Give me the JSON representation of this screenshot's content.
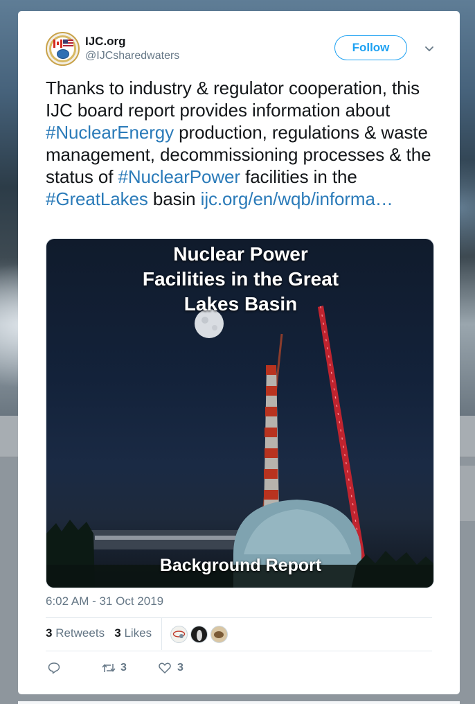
{
  "tweet": {
    "author": {
      "name": "IJC.org",
      "handle": "@IJCsharedwaters",
      "avatar_icon": "ijc-seal-logo"
    },
    "follow_label": "Follow",
    "menu_icon": "chevron-down-icon",
    "text": {
      "part1": "Thanks to industry & regulator cooperation, this IJC board report provides information about ",
      "hashtag1": "#NuclearEnergy",
      "part2": " production, regulations & waste management, decommissioning processes & the status of ",
      "hashtag2": "#NuclearPower",
      "part3": " facilities in the ",
      "hashtag3": "#GreatLakes",
      "part4": " basin ",
      "link": "ijc.org/en/wqb/informa…"
    },
    "media": {
      "title": "Nuclear Power Facilities in the Great Lakes Basin",
      "caption": "Background Report"
    },
    "timestamp": "6:02 AM - 31 Oct 2019",
    "stats": {
      "retweets_count": "3",
      "retweets_label": "Retweets",
      "likes_count": "3",
      "likes_label": "Likes"
    },
    "actions": {
      "reply_icon": "reply-icon",
      "retweet_icon": "retweet-icon",
      "retweet_count": "3",
      "like_icon": "heart-icon",
      "like_count": "3"
    },
    "colors": {
      "link": "#2b7bb9",
      "accent": "#1da1f2",
      "muted": "#657786",
      "text": "#14171a"
    }
  }
}
